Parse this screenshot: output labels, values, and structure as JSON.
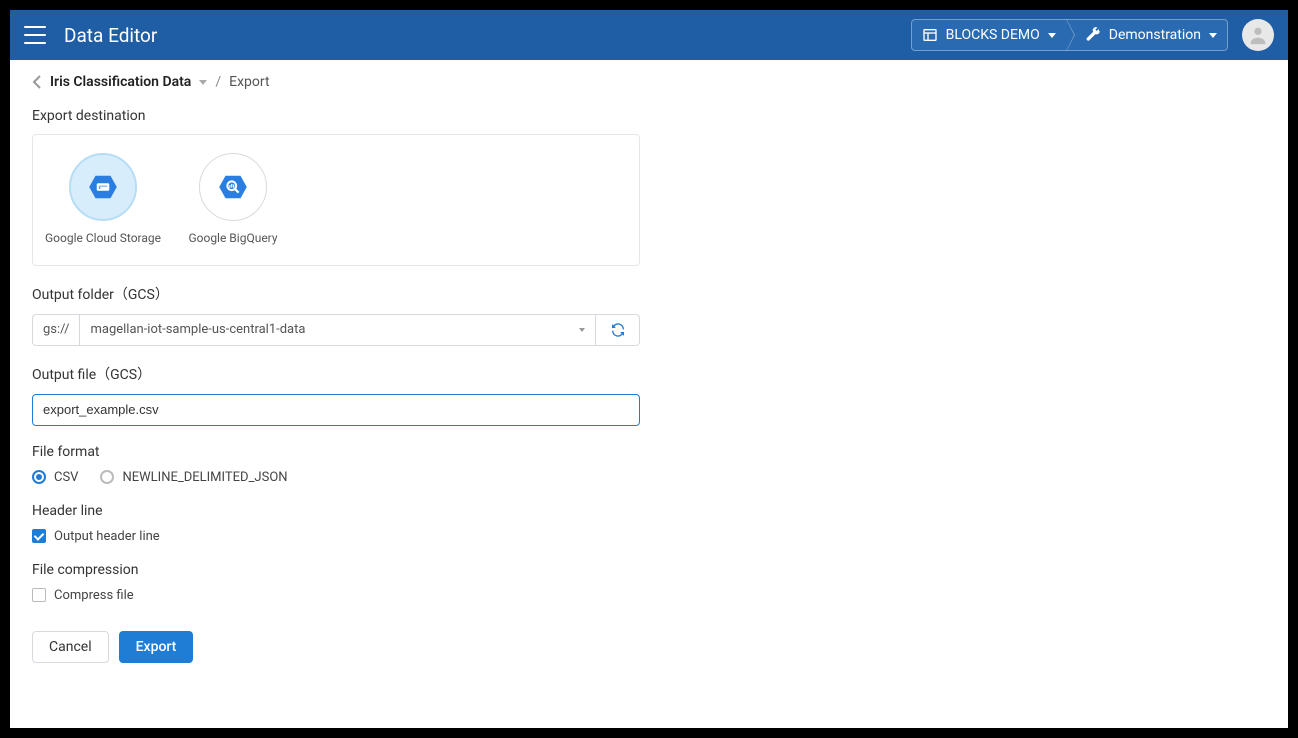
{
  "header": {
    "app_title": "Data Editor",
    "project_label": "BLOCKS DEMO",
    "demo_label": "Demonstration"
  },
  "breadcrumb": {
    "title": "Iris Classification Data",
    "current": "Export"
  },
  "sections": {
    "destination": "Export destination",
    "output_folder": "Output folder（GCS）",
    "output_file": "Output file（GCS）",
    "file_format": "File format",
    "header_line": "Header line",
    "file_compression": "File compression"
  },
  "destinations": {
    "gcs": "Google Cloud Storage",
    "bigquery": "Google BigQuery"
  },
  "folder": {
    "prefix": "gs://",
    "value": "magellan-iot-sample-us-central1-data"
  },
  "output_file_value": "export_example.csv",
  "formats": {
    "csv": "CSV",
    "json": "NEWLINE_DELIMITED_JSON"
  },
  "checks": {
    "header": "Output header line",
    "compress": "Compress file"
  },
  "buttons": {
    "cancel": "Cancel",
    "export": "Export"
  }
}
